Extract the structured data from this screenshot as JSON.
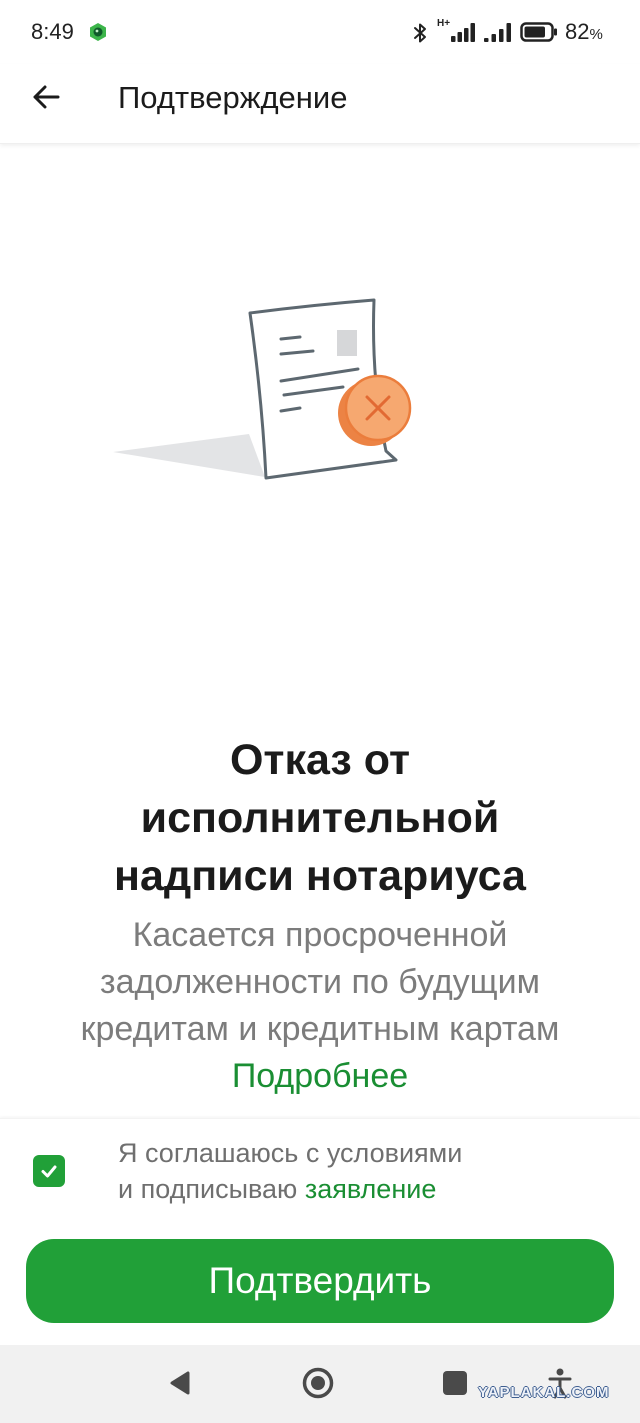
{
  "status_bar": {
    "time": "8:49",
    "network_type": "H+",
    "battery_level": 82,
    "battery_unit": "%",
    "icons": {
      "app": "app-shield-icon",
      "bluetooth": "bluetooth-icon",
      "signal_1": "signal-icon",
      "signal_2": "signal-icon",
      "battery": "battery-icon"
    }
  },
  "app_bar": {
    "back_icon": "arrow-left-icon",
    "title": "Подтверждение"
  },
  "illustration": {
    "icon": "rejected-document-icon"
  },
  "content": {
    "title_lines": [
      "Отказ от",
      "исполнительной",
      "надписи нотариуса"
    ],
    "description_lines": [
      "Касается просроченной",
      "задолженности по будущим",
      "кредитам и кредитным картам"
    ],
    "more_link": "Подробнее"
  },
  "agreement": {
    "checked": true,
    "check_icon": "checkmark-icon",
    "line1": "Я соглашаюсь с условиями",
    "line2_text": "и подписываю",
    "line2_link": "заявление"
  },
  "confirm_button": {
    "label": "Подтвердить"
  },
  "nav_bar": {
    "icons": [
      "triangle-back-icon",
      "circle-home-icon",
      "square-recents-icon",
      "accessibility-icon"
    ]
  },
  "watermark": "YAPLAKAL.COM",
  "colors": {
    "accent": "#21a038",
    "link": "#1a8e33",
    "title_text": "#1b1b1b",
    "secondary_text": "#7c7c7c",
    "reject_badge": "#f6a870",
    "nav_background": "#f1f1f1"
  }
}
